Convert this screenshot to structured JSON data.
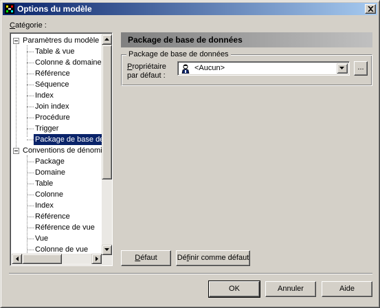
{
  "window": {
    "title": "Options du modèle"
  },
  "category": {
    "label_prefix": "",
    "label_accel": "C",
    "label_rest": "atégorie :"
  },
  "tree": {
    "group1": {
      "label": "Paramètres du modèle",
      "items": [
        "Table & vue",
        "Colonne & domaine",
        "Référence",
        "Séquence",
        "Index",
        "Join index",
        "Procédure",
        "Trigger",
        "Package de base de données"
      ]
    },
    "group2": {
      "label": "Conventions de dénomination",
      "items": [
        "Package",
        "Domaine",
        "Table",
        "Colonne",
        "Index",
        "Référence",
        "Référence de vue",
        "Vue",
        "Colonne de vue"
      ]
    },
    "selected": "Package de base de données"
  },
  "panel": {
    "header": "Package de base de données",
    "group_label": "Package de base de données",
    "owner_label_accel": "P",
    "owner_label_rest1": "ropriétaire",
    "owner_label_line2": "par défaut :",
    "owner_value": "<Aucun>",
    "browse_label": "..."
  },
  "buttons": {
    "defaut_accel": "D",
    "defaut_rest": "éfaut",
    "set_default_prefix": "Dé",
    "set_default_accel": "f",
    "set_default_rest": "inir comme défaut",
    "ok": "OK",
    "annuler": "Annuler",
    "aide": "Aide"
  },
  "icons": {
    "app": "model-options-icon",
    "close": "close-icon",
    "owner": "user-icon",
    "dropdown": "chevron-down-icon",
    "scroll_up": "arrow-up-icon",
    "scroll_down": "arrow-down-icon",
    "scroll_left": "arrow-left-icon",
    "scroll_right": "arrow-right-icon"
  },
  "colors": {
    "titlebar_start": "#0a246a",
    "titlebar_end": "#a6caf0",
    "selection": "#0a246a",
    "face": "#d4d0c8"
  }
}
